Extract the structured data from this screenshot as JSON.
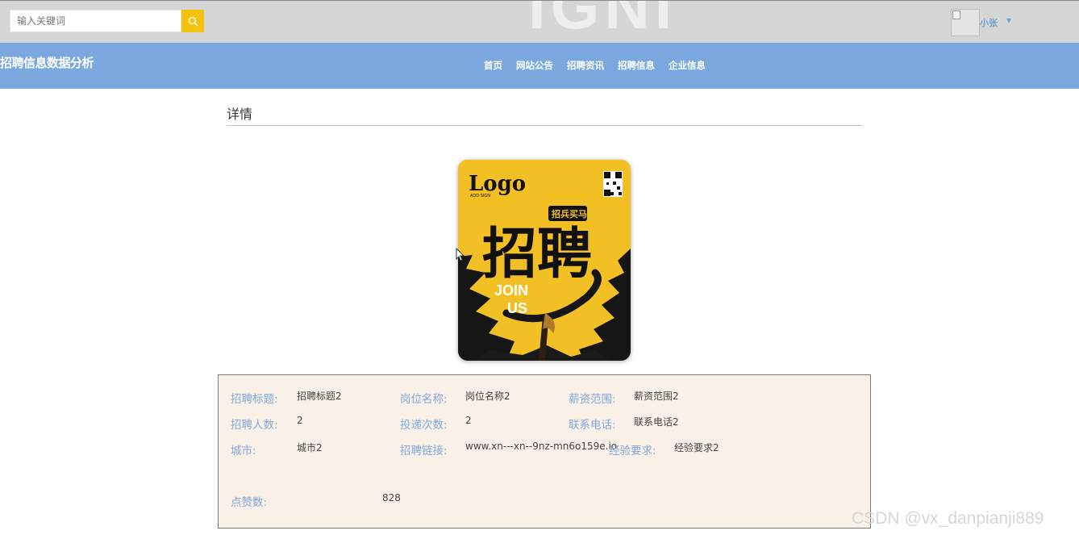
{
  "header": {
    "bg_watermark_text": "IGNI",
    "search": {
      "placeholder": "输入关键词",
      "value": ""
    },
    "search_button_icon": "search-icon",
    "user": {
      "avatar_icon": "broken-image-icon",
      "name": "小张",
      "caret_icon": "caret-down-icon"
    }
  },
  "navbar": {
    "site_title": "招聘信息数据分析",
    "items": [
      "首页",
      "网站公告",
      "招聘资讯",
      "招聘信息",
      "企业信息"
    ]
  },
  "detail": {
    "section_title": "详情",
    "poster": {
      "logo": "Logo",
      "logo_sub": "ADD SIGN",
      "tag": "招兵买马",
      "main_text": "招聘",
      "join_line1": "JOIN",
      "join_line2": "US"
    },
    "fields": {
      "title": {
        "label": "招聘标题:",
        "value": "招聘标题2"
      },
      "position": {
        "label": "岗位名称:",
        "value": "岗位名称2"
      },
      "salary": {
        "label": "薪资范围:",
        "value": "薪资范围2"
      },
      "headcount": {
        "label": "招聘人数:",
        "value": "2"
      },
      "applications": {
        "label": "投递次数:",
        "value": "2"
      },
      "phone": {
        "label": "联系电话:",
        "value": "联系电话2"
      },
      "city": {
        "label": "城市:",
        "value": "城市2"
      },
      "link": {
        "label": "招聘链接:",
        "value": "www.xn---xn--9nz-mn6o159e.io"
      },
      "experience": {
        "label": "经验要求:",
        "value": "经验要求2"
      },
      "likes": {
        "label": "点赞数:",
        "value": "828"
      }
    }
  },
  "watermark": "CSDN @vx_danpianji889",
  "colors": {
    "nav_bg": "#7ba9df",
    "search_btn": "#f5c20d",
    "label": "#80a8dc",
    "panel_bg": "#f9f1e7",
    "poster_bg": "#f2bf24"
  }
}
